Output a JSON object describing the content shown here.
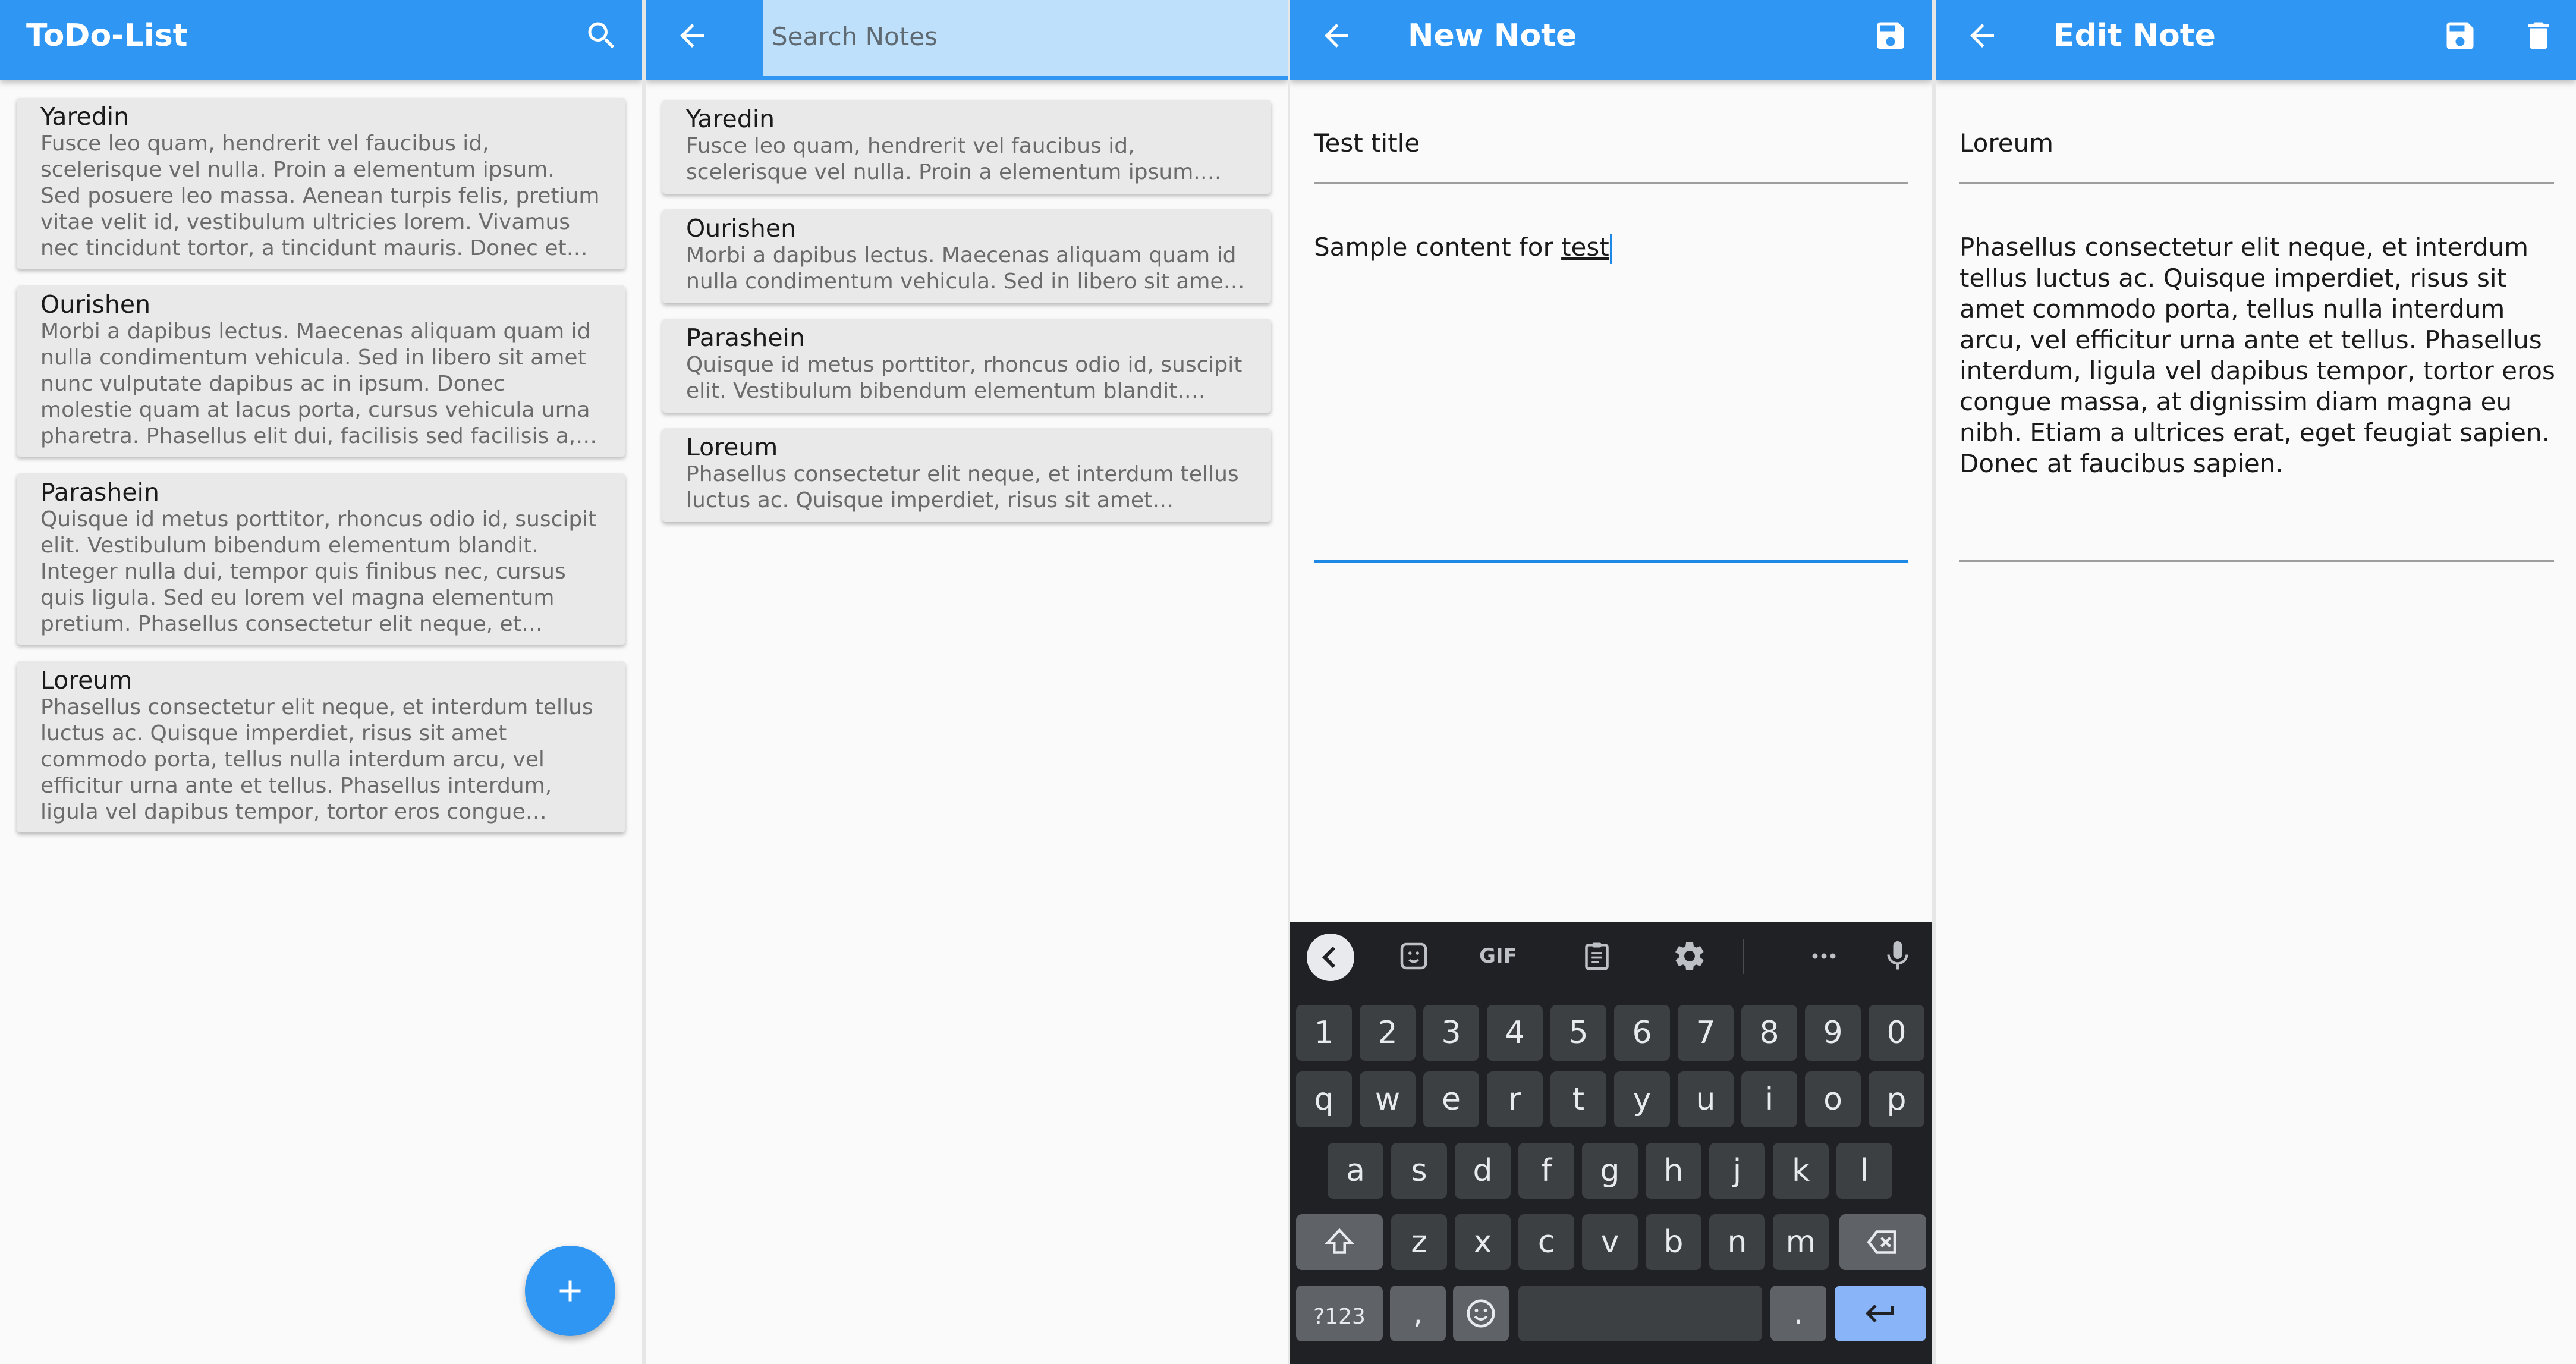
{
  "screen1": {
    "title": "ToDo-List",
    "notes": [
      {
        "title": "Yaredin",
        "body": "Fusce leo quam, hendrerit vel faucibus id, scelerisque vel nulla. Proin a elementum ipsum. Sed posuere leo massa. Aenean turpis felis, pretium vitae velit id, vestibulum ultricies lorem. Vivamus nec tincidunt tortor, a tincidunt mauris. Donec et lobortis nibh. …"
      },
      {
        "title": "Ourishen",
        "body": "Morbi a dapibus lectus. Maecenas aliquam quam id nulla condimentum vehicula. Sed in libero sit amet nunc vulputate dapibus ac in ipsum. Donec molestie quam at lacus porta, cursus vehicula urna pharetra. Phasellus elit dui, facilisis sed facilisis a, feugiat ut …"
      },
      {
        "title": "Parashein",
        "body": "Quisque id metus porttitor, rhoncus odio id, suscipit elit. Vestibulum bibendum elementum blandit. Integer nulla dui, tempor quis finibus nec, cursus quis ligula. Sed eu lorem vel magna elementum pretium. Phasellus consectetur elit neque, et interdum tellus luctus ac. …"
      },
      {
        "title": "Loreum",
        "body": "Phasellus consectetur elit neque, et interdum tellus luctus ac. Quisque imperdiet, risus sit amet commodo porta, tellus nulla interdum arcu, vel efficitur urna ante et tellus. Phasellus interdum, ligula vel dapibus tempor, tortor eros congue massa, at dignissim diam magna …"
      }
    ],
    "fab_label": "+"
  },
  "screen2": {
    "search_placeholder": "Search Notes",
    "notes": [
      {
        "title": "Yaredin",
        "body": "Fusce leo quam, hendrerit vel faucibus id, scelerisque vel nulla. Proin a elementum ipsum. Sed posuere leo …"
      },
      {
        "title": "Ourishen",
        "body": "Morbi a dapibus lectus. Maecenas aliquam quam id nulla condimentum vehicula. Sed in libero sit amet …"
      },
      {
        "title": "Parashein",
        "body": "Quisque id metus porttitor, rhoncus odio id, suscipit elit. Vestibulum bibendum elementum blandit. Integer…"
      },
      {
        "title": "Loreum",
        "body": "Phasellus consectetur elit neque, et interdum tellus luctus ac. Quisque imperdiet, risus sit amet commod…"
      }
    ]
  },
  "screen3": {
    "title": "New Note",
    "title_value": "Test title",
    "content_prefix": "Sample content for ",
    "content_word": "test",
    "keyboard": {
      "gif_label": "GIF",
      "row_numbers": [
        "1",
        "2",
        "3",
        "4",
        "5",
        "6",
        "7",
        "8",
        "9",
        "0"
      ],
      "row1": [
        "q",
        "w",
        "e",
        "r",
        "t",
        "y",
        "u",
        "i",
        "o",
        "p"
      ],
      "row2": [
        "a",
        "s",
        "d",
        "f",
        "g",
        "h",
        "j",
        "k",
        "l"
      ],
      "row3": [
        "z",
        "x",
        "c",
        "v",
        "b",
        "n",
        "m"
      ],
      "symbols_label": "?123",
      "comma_label": ",",
      "period_label": "."
    }
  },
  "screen4": {
    "title": "Edit Note",
    "title_value": "Loreum",
    "content_value": "Phasellus consectetur elit neque, et interdum tellus luctus ac. Quisque imperdiet, risus sit amet commodo porta, tellus nulla interdum arcu, vel efficitur urna ante et tellus. Phasellus interdum, ligula vel dapibus tempor, tortor eros congue massa, at dignissim diam magna eu nibh. Etiam a ultrices erat, eget feugiat sapien. Donec at faucibus sapien."
  },
  "colors": {
    "primary": "#2f96f3",
    "search_field": "#bfe0fa",
    "card": "#e9e9e9",
    "keyboard_bg": "#202124",
    "key": "#3c4043",
    "enter_key": "#8ab4f8"
  },
  "icons": [
    "search-icon",
    "back-arrow-icon",
    "save-icon",
    "delete-icon",
    "add-icon",
    "sticker-icon",
    "clipboard-icon",
    "settings-icon",
    "more-icon",
    "mic-icon",
    "shift-icon",
    "backspace-icon",
    "emoji-icon",
    "enter-icon"
  ]
}
